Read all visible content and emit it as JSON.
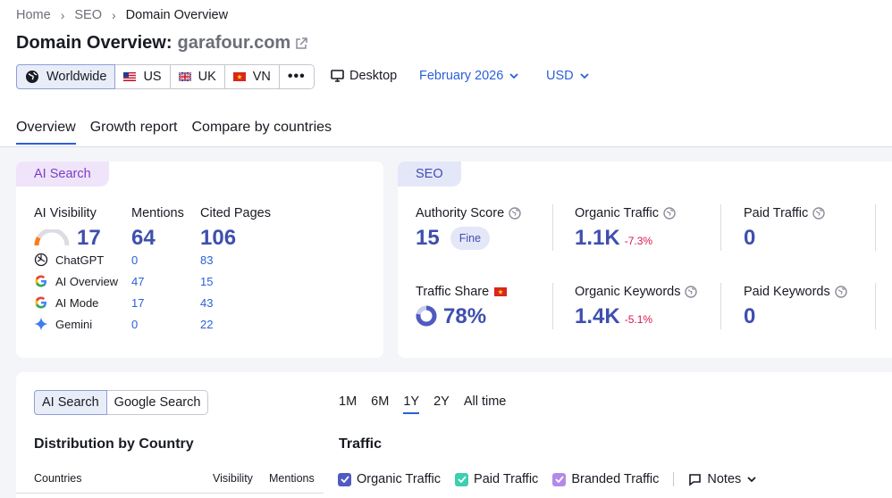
{
  "breadcrumb": {
    "home": "Home",
    "seo": "SEO",
    "current": "Domain Overview"
  },
  "page": {
    "title": "Domain Overview:",
    "domain": "garafour.com"
  },
  "databases": [
    {
      "label": "Worldwide",
      "icon": "globe-icon",
      "active": true
    },
    {
      "label": "US",
      "icon": "us-flag-icon"
    },
    {
      "label": "UK",
      "icon": "uk-flag-icon"
    },
    {
      "label": "VN",
      "icon": "vn-flag-icon"
    },
    {
      "label": "•••",
      "icon": "more-icon"
    }
  ],
  "device": "Desktop",
  "date": "February 2026",
  "currency": "USD",
  "tabs": [
    "Overview",
    "Growth report",
    "Compare by countries"
  ],
  "ai_card": {
    "pill": "AI Search",
    "visibility_label": "AI Visibility",
    "visibility_value": "17",
    "mentions_label": "Mentions",
    "mentions_value": "64",
    "cited_label": "Cited Pages",
    "cited_value": "106",
    "rows": [
      {
        "name": "ChatGPT",
        "mentions": "0",
        "cited": "83"
      },
      {
        "name": "AI Overview",
        "mentions": "47",
        "cited": "15"
      },
      {
        "name": "AI Mode",
        "mentions": "17",
        "cited": "43"
      },
      {
        "name": "Gemini",
        "mentions": "0",
        "cited": "22"
      }
    ]
  },
  "seo_card": {
    "pill": "SEO",
    "authority_label": "Authority Score",
    "authority_value": "15",
    "authority_badge": "Fine",
    "organic_traffic_label": "Organic Traffic",
    "organic_traffic_value": "1.1K",
    "organic_traffic_delta": "-7.3%",
    "paid_traffic_label": "Paid Traffic",
    "paid_traffic_value": "0",
    "traffic_share_label": "Traffic Share",
    "traffic_share_value": "78%",
    "traffic_share_fraction": 0.78,
    "organic_keywords_label": "Organic Keywords",
    "organic_keywords_value": "1.4K",
    "organic_keywords_delta": "-5.1%",
    "paid_keywords_label": "Paid Keywords",
    "paid_keywords_value": "0"
  },
  "bottom": {
    "segments": [
      "AI Search",
      "Google Search"
    ],
    "periods": [
      "1M",
      "6M",
      "1Y",
      "2Y",
      "All time"
    ],
    "active_period": "1Y",
    "distribution_title": "Distribution by Country",
    "col_countries": "Countries",
    "col_visibility": "Visibility",
    "col_mentions": "Mentions",
    "traffic_title": "Traffic",
    "legend": [
      {
        "label": "Organic Traffic",
        "color": "#4f5bc0"
      },
      {
        "label": "Paid Traffic",
        "color": "#3ccfb0"
      },
      {
        "label": "Branded Traffic",
        "color": "#b48ae8"
      }
    ],
    "notes": "Notes"
  },
  "colors": {
    "accent": "#2b5fd9",
    "metric": "#3f4fae",
    "negative": "#d6194a"
  }
}
